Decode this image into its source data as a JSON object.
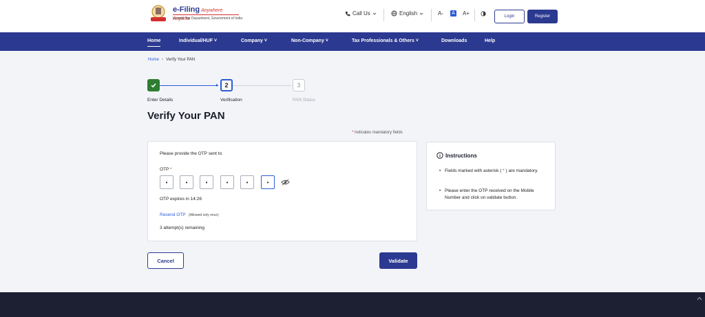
{
  "header": {
    "brand": "e-Filing",
    "tagline": "Anywhere Anytime",
    "department": "Income Tax Department, Government of India",
    "call_us": "Call Us",
    "language": "English",
    "font_decrease": "A-",
    "font_normal": "A",
    "font_increase": "A+",
    "login": "Login",
    "register": "Register"
  },
  "nav": {
    "items": [
      {
        "label": "Home"
      },
      {
        "label": "Individual/HUF"
      },
      {
        "label": "Company"
      },
      {
        "label": "Non-Company"
      },
      {
        "label": "Tax Professionals & Others"
      },
      {
        "label": "Downloads"
      },
      {
        "label": "Help"
      }
    ]
  },
  "breadcrumb": {
    "home": "Home",
    "separator": "›",
    "current": "Verify Your PAN"
  },
  "stepper": {
    "steps": [
      {
        "number": "",
        "label": "Enter Details",
        "state": "done"
      },
      {
        "number": "2",
        "label": "Verification",
        "state": "current"
      },
      {
        "number": "3",
        "label": "PAN Status",
        "state": "todo"
      }
    ]
  },
  "page": {
    "title": "Verify Your PAN",
    "mandatory_star": "*",
    "mandatory_text": "Indicates mandatory fields"
  },
  "otp_card": {
    "prompt": "Please provide the OTP sent to",
    "otp_label": "OTP",
    "otp_star": "*",
    "otp_digits": [
      "•",
      "•",
      "•",
      "•",
      "•",
      "•"
    ],
    "expires": "OTP expires in 14:26",
    "resend": "Resend OTP",
    "resend_note": "(Allowed only once)",
    "attempts": "3 attempt(s) remaining"
  },
  "instructions": {
    "title": "Instructions",
    "bullet1_pre": "Fields marked with asterisk (",
    "bullet1_star": " * ",
    "bullet1_post": ") are mandatory.",
    "bullet2": "Please enter the OTP received on the Mobile Number and click on validate button."
  },
  "actions": {
    "cancel": "Cancel",
    "validate": "Validate"
  },
  "colors": {
    "primary": "#2b3990",
    "accent_blue": "#2b5cd6",
    "success": "#2e7d32",
    "required": "#d32f2f",
    "footer": "#1d2033"
  }
}
